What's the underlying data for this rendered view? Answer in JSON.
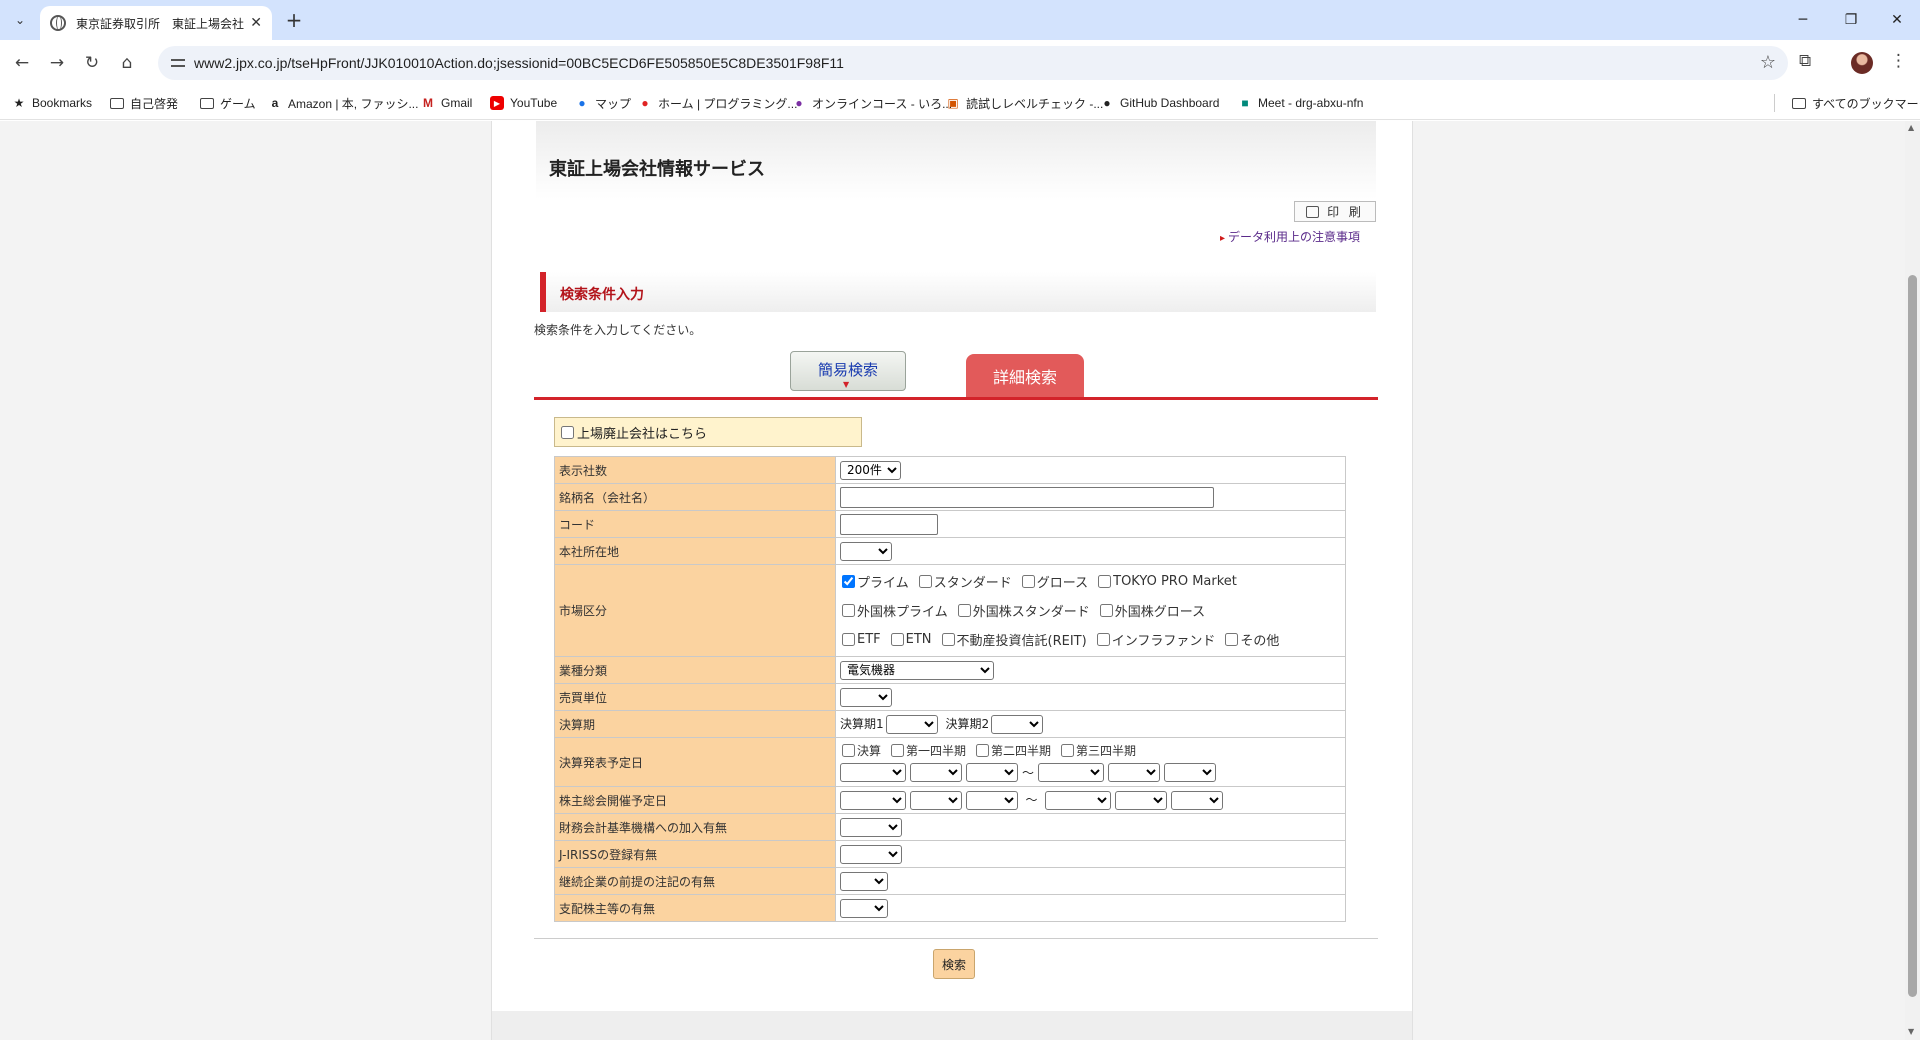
{
  "browser": {
    "tab_title": "東京証券取引所　東証上場会社",
    "tab_close": "✕",
    "new_tab": "+",
    "url": "www2.jpx.co.jp/tseHpFront/JJK010010Action.do;jsessionid=00BC5ECD6FE505850E5C8DE3501F98F11",
    "window_controls": {
      "minimize": "─",
      "restore": "❐",
      "close": "✕"
    },
    "icons": [
      "menu-icon",
      "back-icon",
      "forward-icon",
      "reload-icon",
      "home-icon",
      "star-icon",
      "extensions-icon",
      "kebab-menu-icon"
    ]
  },
  "bookmarks": {
    "items": [
      {
        "label": "Bookmarks",
        "icon": "star-icon"
      },
      {
        "label": "自己啓発",
        "icon": "folder-icon"
      },
      {
        "label": "ゲーム",
        "icon": "folder-icon"
      },
      {
        "label": "Amazon | 本, ファッシ...",
        "icon": "amazon-icon"
      },
      {
        "label": "Gmail",
        "icon": "gmail-icon"
      },
      {
        "label": "YouTube",
        "icon": "youtube-icon"
      },
      {
        "label": "マップ",
        "icon": "maps-icon"
      },
      {
        "label": "ホーム | プログラミング...",
        "icon": "site-icon"
      },
      {
        "label": "オンラインコース - いろ...",
        "icon": "course-icon"
      },
      {
        "label": "読試しレベルチェック -...",
        "icon": "level-check-icon"
      },
      {
        "label": "GitHub Dashboard",
        "icon": "github-icon"
      },
      {
        "label": "Meet - drg-abxu-nfn",
        "icon": "meet-icon"
      }
    ],
    "all_bookmarks": "すべてのブックマーク"
  },
  "page": {
    "title": "東証上場会社情報サービス",
    "print_button": "印 刷",
    "notice_link": "データ利用上の注意事項",
    "section_title": "検索条件入力",
    "instruction": "検索条件を入力してください。",
    "tab_simple": "簡易検索",
    "tab_detail": "詳細検索",
    "delisted_checkbox": "上場廃止会社はこちら",
    "search_button": "検索"
  },
  "form": {
    "display_count": {
      "label": "表示社数",
      "value": "200件"
    },
    "company_name": {
      "label": "銘柄名（会社名）",
      "value": ""
    },
    "code": {
      "label": "コード",
      "value": ""
    },
    "hq_location": {
      "label": "本社所在地",
      "value": ""
    },
    "market": {
      "label": "市場区分",
      "row1": [
        {
          "label": "プライム",
          "checked": true
        },
        {
          "label": "スタンダード",
          "checked": false
        },
        {
          "label": "グロース",
          "checked": false
        },
        {
          "label": "TOKYO PRO Market",
          "checked": false
        }
      ],
      "row2": [
        {
          "label": "外国株プライム",
          "checked": false
        },
        {
          "label": "外国株スタンダード",
          "checked": false
        },
        {
          "label": "外国株グロース",
          "checked": false
        }
      ],
      "row3": [
        {
          "label": "ETF",
          "checked": false
        },
        {
          "label": "ETN",
          "checked": false
        },
        {
          "label": "不動産投資信託(REIT)",
          "checked": false
        },
        {
          "label": "インフラファンド",
          "checked": false
        },
        {
          "label": "その他",
          "checked": false
        }
      ]
    },
    "industry": {
      "label": "業種分類",
      "value": "電気機器"
    },
    "trading_unit": {
      "label": "売買単位",
      "value": ""
    },
    "fiscal_period": {
      "label": "決算期",
      "period1": "決算期1",
      "period2": "決算期2"
    },
    "announcement_date": {
      "label": "決算発表予定日",
      "checks": [
        "決算",
        "第一四半期",
        "第二四半期",
        "第三四半期"
      ],
      "tilde": "～"
    },
    "agm_date": {
      "label": "株主総会開催予定日",
      "tilde": "～"
    },
    "fasf": {
      "label": "財務会計基準機構への加入有無"
    },
    "jiriss": {
      "label": "J-IRISSの登録有無"
    },
    "going_concern": {
      "label": "継続企業の前提の注記の有無"
    },
    "controlling_shareholder": {
      "label": "支配株主等の有無"
    }
  },
  "colors": {
    "accent_red": "#d3232a",
    "tab_detail_bg": "#e25a5a",
    "label_bg": "#fbd3a0",
    "notice_box_bg": "#fff3cd",
    "link_purple": "#5a2a8a"
  }
}
